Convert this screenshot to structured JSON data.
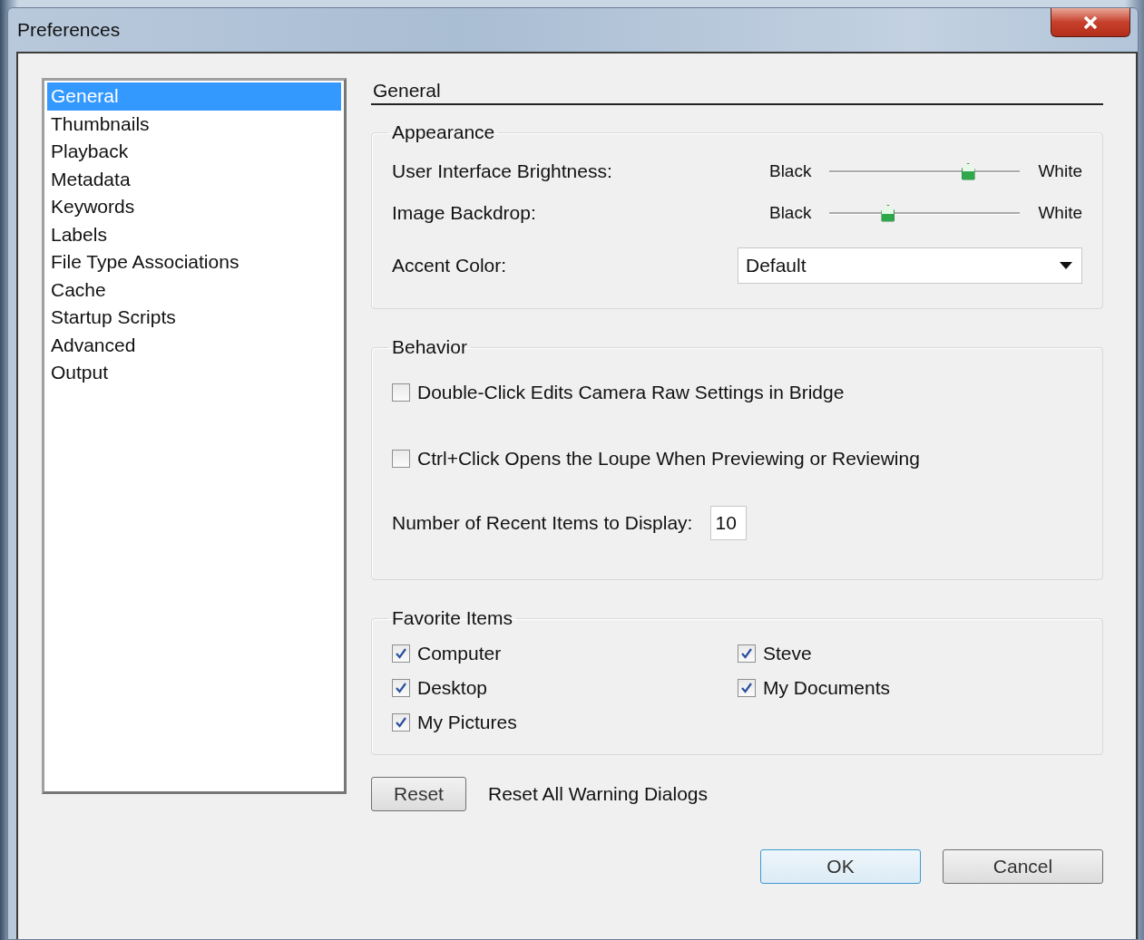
{
  "window": {
    "title": "Preferences"
  },
  "sidebar": {
    "items": [
      {
        "label": "General",
        "selected": true
      },
      {
        "label": "Thumbnails",
        "selected": false
      },
      {
        "label": "Playback",
        "selected": false
      },
      {
        "label": "Metadata",
        "selected": false
      },
      {
        "label": "Keywords",
        "selected": false
      },
      {
        "label": "Labels",
        "selected": false
      },
      {
        "label": "File Type Associations",
        "selected": false
      },
      {
        "label": "Cache",
        "selected": false
      },
      {
        "label": "Startup Scripts",
        "selected": false
      },
      {
        "label": "Advanced",
        "selected": false
      },
      {
        "label": "Output",
        "selected": false
      }
    ]
  },
  "section_title": "General",
  "appearance": {
    "title": "Appearance",
    "sliders": [
      {
        "label": "User Interface Brightness:",
        "min_label": "Black",
        "max_label": "White",
        "level": 0.72
      },
      {
        "label": "Image Backdrop:",
        "min_label": "Black",
        "max_label": "White",
        "level": 0.3
      }
    ],
    "accent_color": {
      "label": "Accent Color:",
      "value": "Default"
    }
  },
  "behavior": {
    "title": "Behavior",
    "checkboxes": [
      {
        "label": "Double-Click Edits Camera Raw Settings in Bridge",
        "checked": false
      },
      {
        "label": "Ctrl+Click Opens the Loupe When Previewing or Reviewing",
        "checked": false
      }
    ],
    "recent_items": {
      "label": "Number of Recent Items to Display:",
      "value": "10"
    }
  },
  "favorites": {
    "title": "Favorite Items",
    "items": [
      {
        "label": "Computer",
        "checked": true
      },
      {
        "label": "Steve",
        "checked": true
      },
      {
        "label": "Desktop",
        "checked": true
      },
      {
        "label": "My Documents",
        "checked": true
      },
      {
        "label": "My Pictures",
        "checked": true
      }
    ]
  },
  "reset": {
    "button": "Reset",
    "label": "Reset All Warning Dialogs"
  },
  "buttons": [
    {
      "label": "OK",
      "default": true
    },
    {
      "label": "Cancel",
      "default": false
    }
  ]
}
